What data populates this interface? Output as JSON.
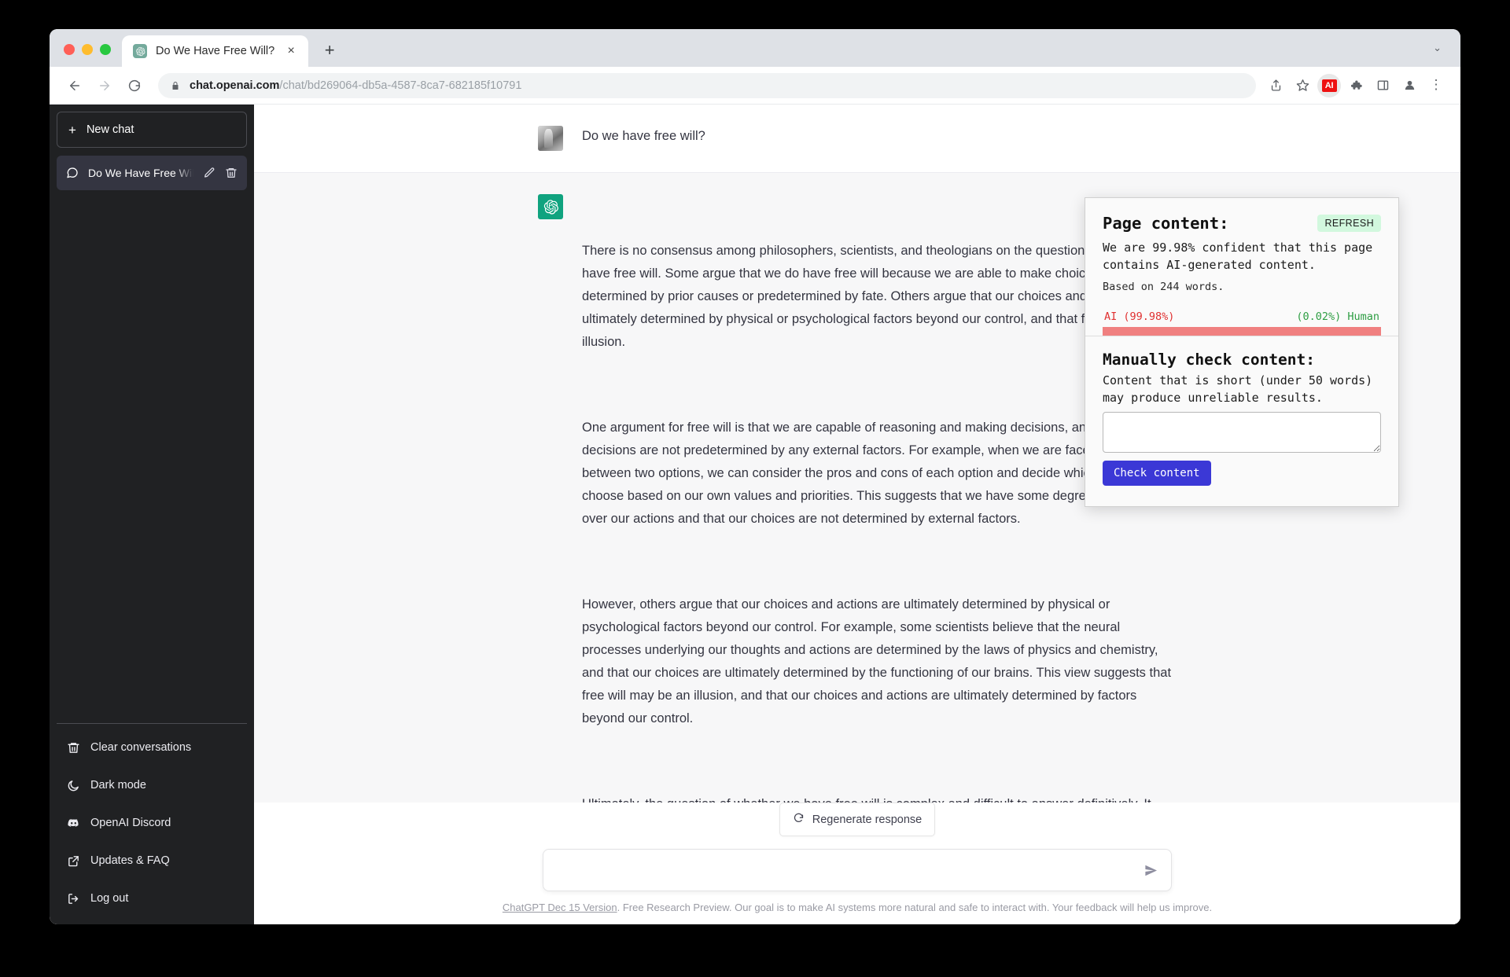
{
  "browser": {
    "tab": {
      "title": "Do We Have Free Will?",
      "favicon": "chatgpt-icon",
      "close": "×"
    },
    "new_tab_label": "+",
    "window_chevron": "⌄",
    "omnibox": {
      "domain": "chat.openai.com",
      "path": "/chat/bd269064-db5a-4587-8ca7-682185f10791",
      "full_url": "chat.openai.com/chat/bd269064-db5a-4587-8ca7-682185f10791",
      "lock": "lock-icon"
    },
    "actions": {
      "back": "back-icon",
      "forward": "forward-icon",
      "reload": "reload-icon",
      "share": "share-icon",
      "bookmark": "star-icon",
      "extension_ai_label": "AI",
      "extensions": "puzzle-icon",
      "side_panel": "side-panel-icon",
      "profile": "profile-icon",
      "menu": "⋮"
    }
  },
  "sidebar": {
    "new_chat_label": "New chat",
    "new_chat_plus": "+",
    "conversations": [
      {
        "title": "Do We Have Free Will?",
        "active": true
      }
    ],
    "menu_items": [
      {
        "label": "Clear conversations",
        "icon": "trash-icon"
      },
      {
        "label": "Dark mode",
        "icon": "moon-icon"
      },
      {
        "label": "OpenAI Discord",
        "icon": "discord-icon"
      },
      {
        "label": "Updates & FAQ",
        "icon": "external-link-icon"
      },
      {
        "label": "Log out",
        "icon": "logout-icon"
      }
    ]
  },
  "conversation": {
    "user_message": "Do we have free will?",
    "assistant_paragraphs": [
      "There is no consensus among philosophers, scientists, and theologians on the question of whether we have free will. Some argue that we do have free will because we are able to make choices that are not determined by prior causes or predetermined by fate. Others argue that our choices and actions are ultimately determined by physical or psychological factors beyond our control, and that free will is an illusion.",
      "One argument for free will is that we are capable of reasoning and making decisions, and that these decisions are not predetermined by any external factors. For example, when we are faced with a choice between two options, we can consider the pros and cons of each option and decide which one to choose based on our own values and priorities. This suggests that we have some degree of control over our actions and that our choices are not determined by external factors.",
      "However, others argue that our choices and actions are ultimately determined by physical or psychological factors beyond our control. For example, some scientists believe that the neural processes underlying our thoughts and actions are determined by the laws of physics and chemistry, and that our choices are ultimately determined by the functioning of our brains. This view suggests that free will may be an illusion, and that our choices and actions are ultimately determined by factors beyond our control.",
      "Ultimately, the question of whether we have free will is complex and difficult to answer definitively. It remains a subject of debate among philosophers, scientists, and theologians."
    ]
  },
  "composer": {
    "regenerate_label": "Regenerate response",
    "input_value": "",
    "input_placeholder": "",
    "send_icon": "send-icon"
  },
  "footer": {
    "link_text": "ChatGPT Dec 15 Version",
    "rest_text": ". Free Research Preview. Our goal is to make AI systems more natural and safe to interact with. Your feedback will help us improve."
  },
  "extension_popup": {
    "page_content_title": "Page content:",
    "refresh_label": "REFRESH",
    "confidence_text": "We are 99.98% confident that this page contains AI-generated content.",
    "word_count_text": "Based on 244 words.",
    "gauge": {
      "ai_label": "AI (99.98%)",
      "human_label": "(0.02%) Human",
      "ai_percent": 99.98,
      "human_percent": 0.02,
      "bar_color": "#f08080",
      "ai_text_color": "#e03131",
      "human_text_color": "#2f9e44"
    },
    "manual_title": "Manually check content:",
    "manual_hint": "Content that is short (under 50 words) may produce unreliable results.",
    "manual_textarea_value": "",
    "manual_textarea_placeholder": "",
    "check_button_label": "Check content"
  }
}
